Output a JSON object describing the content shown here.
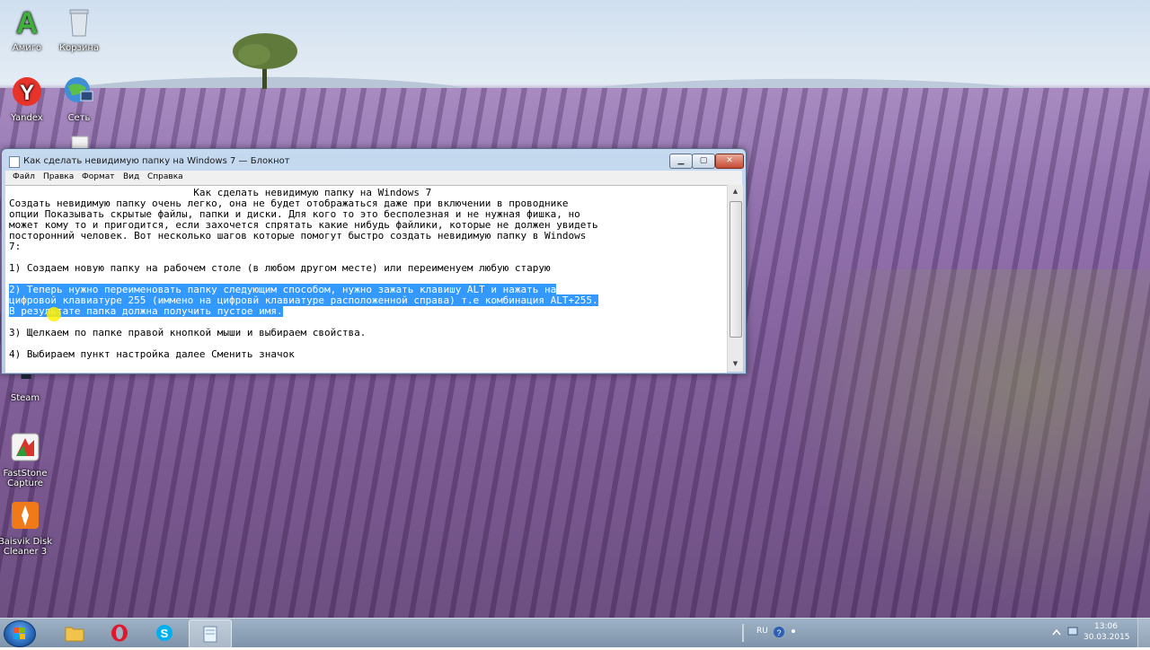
{
  "desktop": {
    "icons": [
      {
        "label": "Амиго"
      },
      {
        "label": "Корзина"
      },
      {
        "label": "Yandex"
      },
      {
        "label": "Сеть"
      },
      {
        "label": "Steam"
      },
      {
        "label": "FastStone Capture"
      },
      {
        "label": "Baisvik Disk Cleaner 3"
      }
    ]
  },
  "window": {
    "title": "Как сделать невидимую папку на Windows 7 — Блокнот",
    "controls": {
      "minimize": "▁",
      "maximize": "▢",
      "close": "✕"
    },
    "menu": [
      "Файл",
      "Правка",
      "Формат",
      "Вид",
      "Справка"
    ],
    "lines": [
      "                               Как сделать невидимую папку на Windows 7",
      "Создать невидимую папку очень легко, она не будет отображаться даже при включении в проводнике",
      "опции Показывать скрытые файлы, папки и диски. Для кого то это бесполезная и не нужная фишка, но",
      "может кому то и пригодится, если захочется спрятать какие нибудь файлики, которые не должен увидеть",
      "посторонний человек. Вот несколько шагов которые помогут быстро создать невидимую папку в Windows",
      "7:",
      "",
      "1) Создаем новую папку на рабочем столе (в любом другом месте) или переименуем любую старую",
      "",
      "2) Теперь нужно переименовать папку следующим способом, нужно зажать клавишу ALT и нажать на",
      "цифровой клавиатуре 255 (иммено на цифровй клавиатуре расположенной справа) т.е комбинация ALT+255.",
      "В результате папка должна получить пустое имя.",
      "",
      "3) Щелкаем по папке правой кнопкой мыши и выбираем свойства.",
      "",
      "4) Выбираем пункт настройка далее Сменить значок"
    ]
  },
  "taskbar": {
    "language": "RU",
    "time": "13:06",
    "date": "30.03.2015"
  },
  "colors": {
    "selection": "#3399ff",
    "taskbar": "#8aa0b8"
  }
}
